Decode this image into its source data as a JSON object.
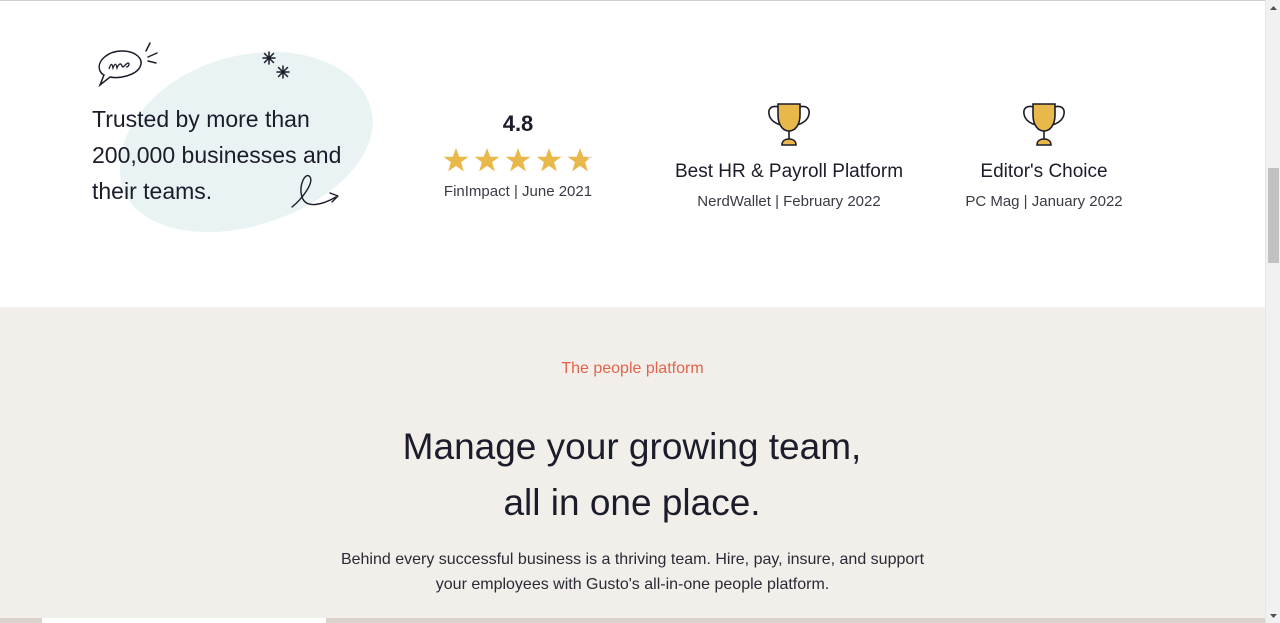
{
  "trust": {
    "tagline": "Trusted by more than 200,000 businesses and their teams.",
    "doodles": [
      "speech-bubble-doodle",
      "sparkle-doodle",
      "swirl-arrow-doodle"
    ]
  },
  "rating": {
    "value": "4.8",
    "stars": 4.8,
    "max_stars": 5,
    "source": "FinImpact | June 2021",
    "star_color": "#e8b84a"
  },
  "awards": [
    {
      "title": "Best HR & Payroll Platform",
      "source": "NerdWallet | February 2022",
      "icon": "trophy-icon"
    },
    {
      "title": "Editor's Choice",
      "source": "PC Mag | January 2022",
      "icon": "trophy-icon"
    }
  ],
  "platform": {
    "eyebrow": "The people platform",
    "headline": "Manage your growing team, all in one place.",
    "body": "Behind every successful business is a thriving team. Hire, pay, insure, and support your employees with Gusto's all-in-one people platform."
  },
  "colors": {
    "accent": "#e1644a",
    "section_bg": "#f2efeb",
    "trophy_gold": "#e8b84a",
    "blob": "#e9f3f4"
  }
}
